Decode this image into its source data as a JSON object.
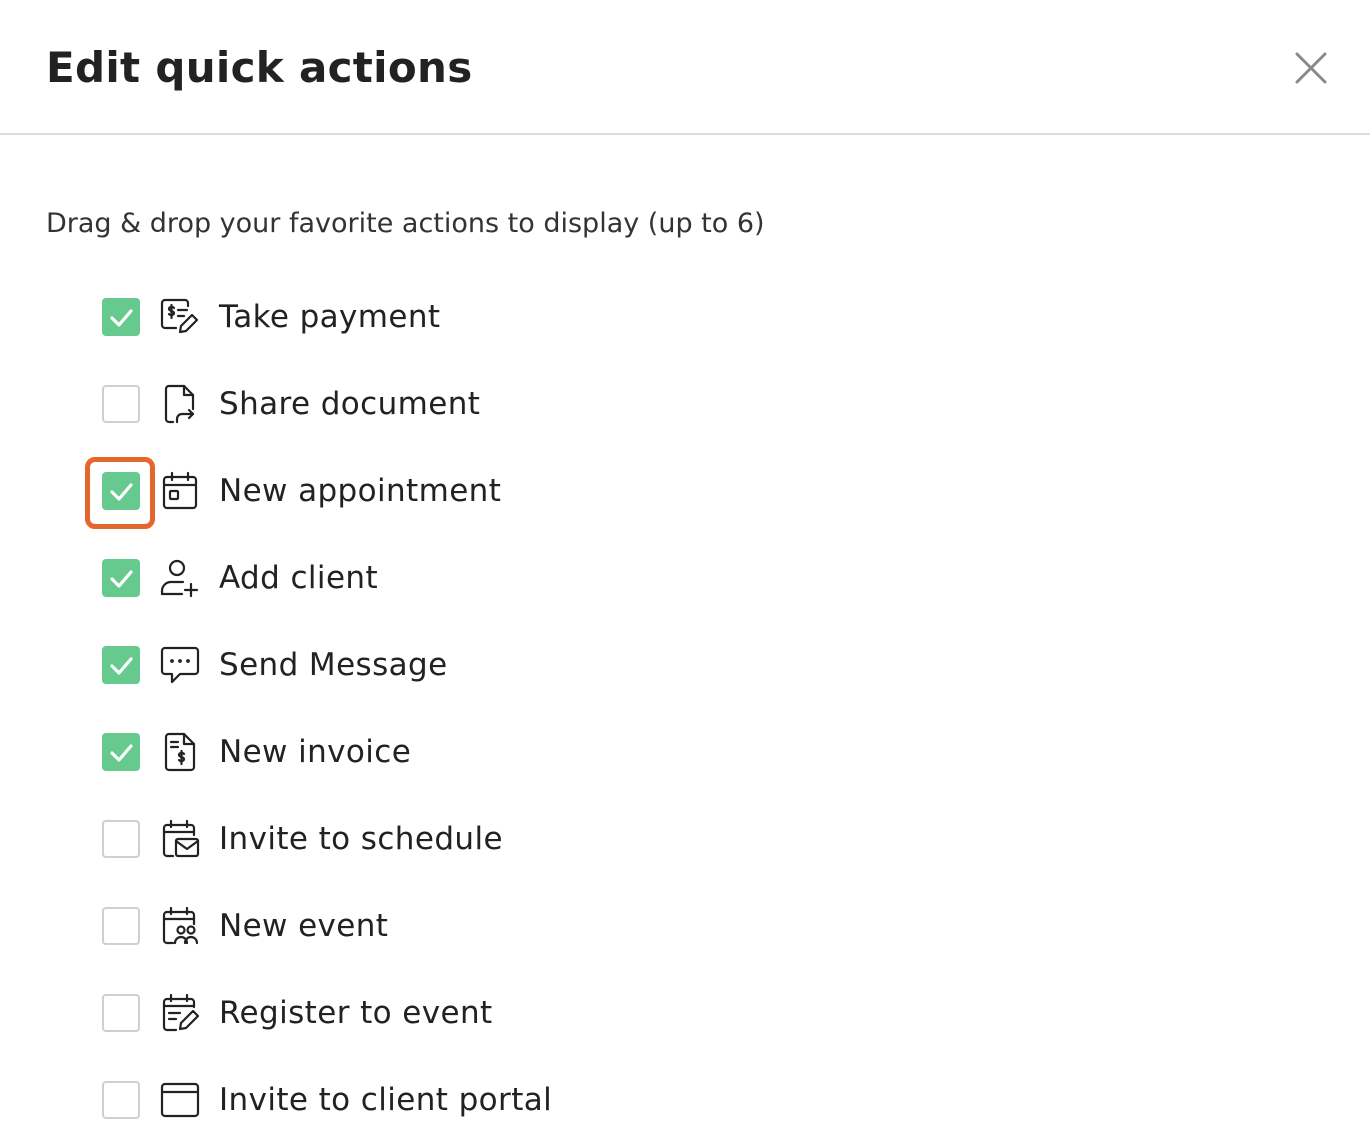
{
  "dialog": {
    "title": "Edit quick actions",
    "close_icon": "close-icon",
    "instructions": "Drag & drop your favorite actions to display (up to 6)"
  },
  "colors": {
    "checked": "#66c98d",
    "unchecked_border": "#cfcfcf",
    "highlight": "#e5672d"
  },
  "actions": [
    {
      "label": "Take payment",
      "checked": true,
      "icon": "payment-icon"
    },
    {
      "label": "Share document",
      "checked": false,
      "icon": "share-document-icon"
    },
    {
      "label": "New appointment",
      "checked": true,
      "icon": "calendar-icon",
      "highlighted": true
    },
    {
      "label": "Add client",
      "checked": true,
      "icon": "add-user-icon"
    },
    {
      "label": "Send Message",
      "checked": true,
      "icon": "message-icon"
    },
    {
      "label": "New invoice",
      "checked": true,
      "icon": "invoice-icon"
    },
    {
      "label": "Invite to schedule",
      "checked": false,
      "icon": "calendar-mail-icon"
    },
    {
      "label": "New event",
      "checked": false,
      "icon": "calendar-group-icon"
    },
    {
      "label": "Register to event",
      "checked": false,
      "icon": "calendar-edit-icon"
    },
    {
      "label": "Invite to client portal",
      "checked": false,
      "icon": "browser-window-icon"
    }
  ]
}
